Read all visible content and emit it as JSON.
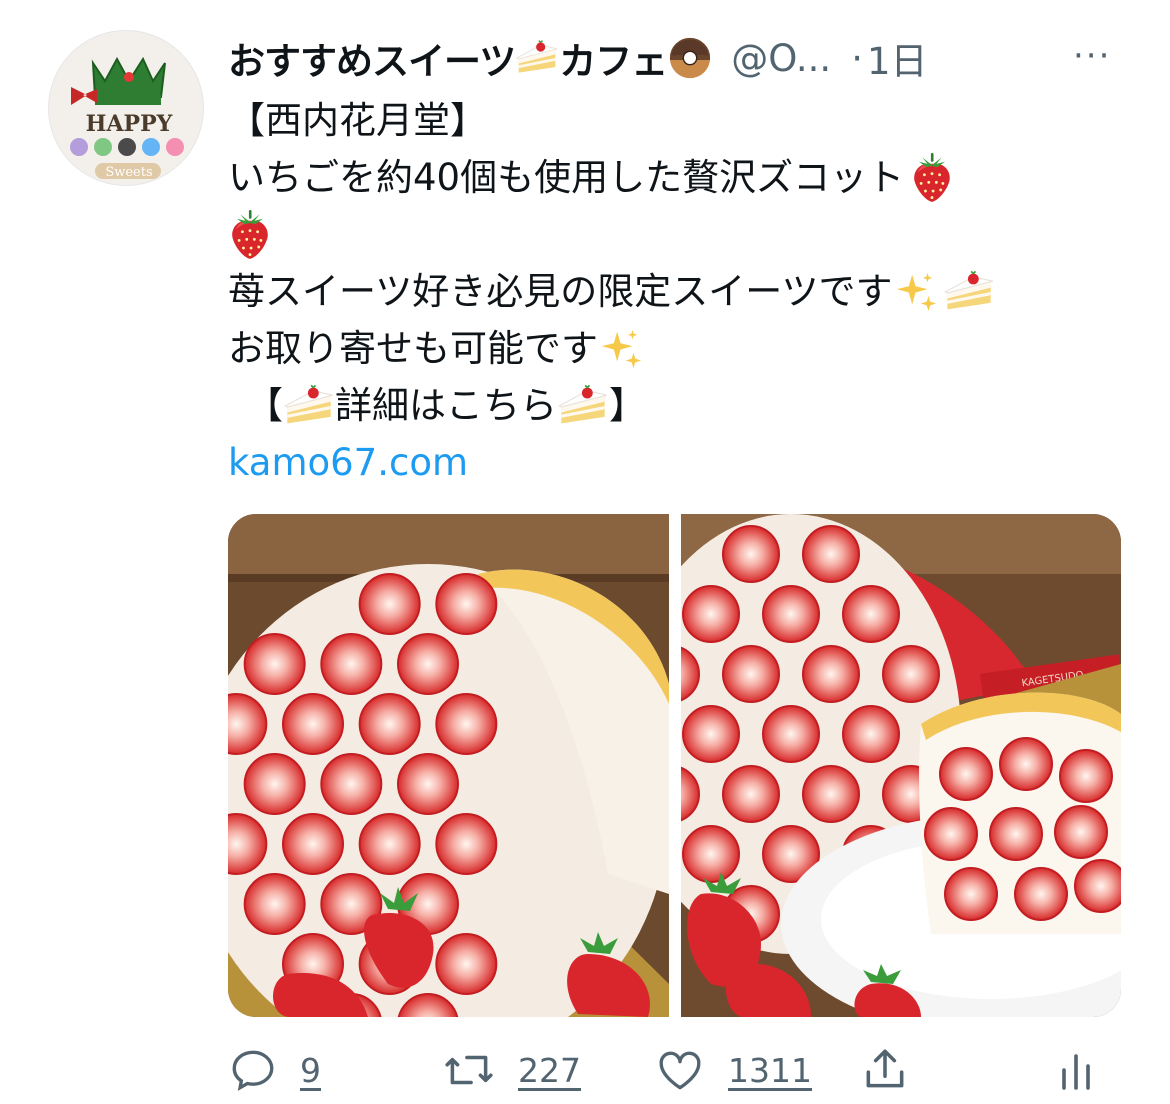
{
  "tweet": {
    "display_name": "おすすめスイーツ",
    "display_name_2": "カフェ",
    "handle": "@O...",
    "time_sep": "·",
    "time": "1日",
    "more_label": "···",
    "avatar_text": {
      "top": "HAPPY",
      "bottom": "Sweets"
    },
    "lines": [
      "【西内花月堂】",
      " いちごを約40個も使用した贅沢ズコット",
      "",
      "苺スイーツ好き必見の限定スイーツです",
      "お取り寄せも可能です",
      "【",
      "詳細はこちら",
      "】"
    ],
    "link": "kamo67.com",
    "icons": {
      "strawberry": "strawberry-icon",
      "cake": "shortcake-icon",
      "donut": "donut-icon",
      "sparkles": "sparkles-icon"
    },
    "photos": [
      {
        "name": "photo-strawberry-dome-cake",
        "ribbon_text": ""
      },
      {
        "name": "photo-strawberry-cake-slice",
        "ribbon_text": "KAGETSUDO"
      }
    ],
    "actions": {
      "reply_count": "9",
      "retweet_count": "227",
      "like_count": "1311"
    }
  },
  "colors": {
    "link": "#1d9bf0",
    "secondary_text": "#536471",
    "strawberry": "#d9262c"
  }
}
